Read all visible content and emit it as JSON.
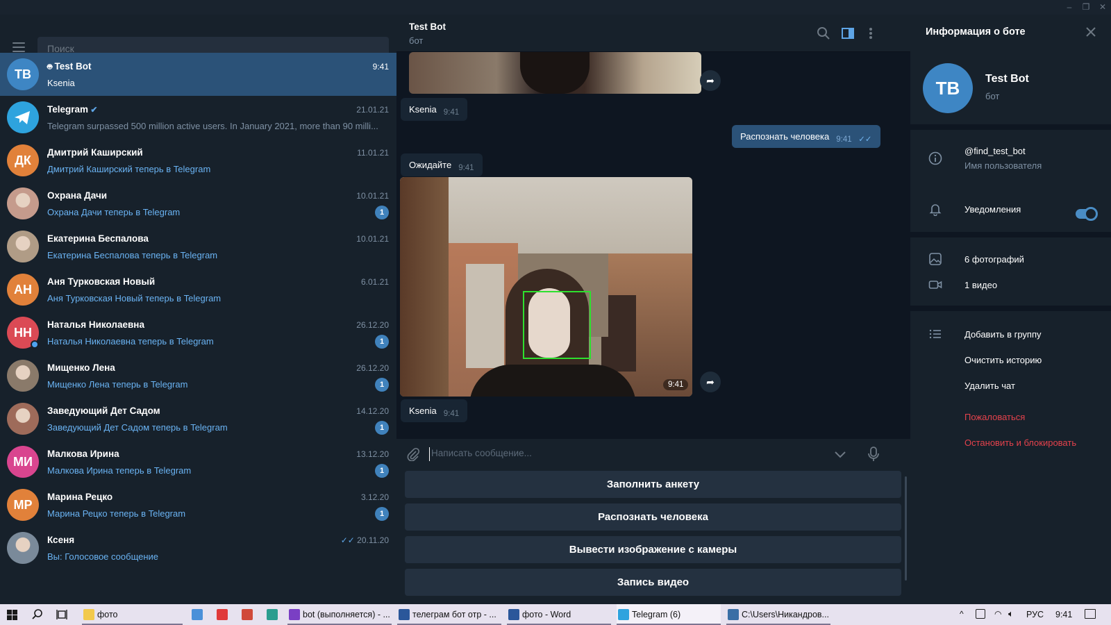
{
  "window": {
    "controls": [
      "–",
      "❐",
      "✕"
    ]
  },
  "search": {
    "placeholder": "Поиск"
  },
  "chats": [
    {
      "initials": "TB",
      "color": "#3e86c4",
      "name": "Test Bot",
      "preview": "Ksenia",
      "time": "9:41",
      "bot": true,
      "active": true
    },
    {
      "initials": "",
      "color": "#2ea3de",
      "name": "Telegram",
      "preview": "Telegram surpassed 500 million active users.    In January 2021, more than 90 milli...",
      "time": "21.01.21",
      "verified": true,
      "grey": true
    },
    {
      "initials": "ДК",
      "color": "#e1813a",
      "name": "Дмитрий Каширский",
      "preview": "Дмитрий Каширский теперь в Telegram",
      "time": "11.01.21"
    },
    {
      "initials": "",
      "color": "#c59b8c",
      "name": "Охрана Дачи",
      "preview": "Охрана Дачи теперь в Telegram",
      "time": "10.01.21",
      "badge": "1"
    },
    {
      "initials": "",
      "color": "#b09c86",
      "name": "Екатерина Беспалова",
      "preview": "Екатерина Беспалова теперь в Telegram",
      "time": "10.01.21"
    },
    {
      "initials": "АН",
      "color": "#e1813a",
      "name": "Аня Турковская Новый",
      "preview": "Аня Турковская Новый теперь в Telegram",
      "time": "6.01.21"
    },
    {
      "initials": "НН",
      "color": "#db4a55",
      "name": "Наталья Николаевна",
      "preview": "Наталья Николаевна теперь в Telegram",
      "time": "26.12.20",
      "badge": "1",
      "online": true
    },
    {
      "initials": "",
      "color": "#8a7a6a",
      "name": "Мищенко Лена",
      "preview": "Мищенко Лена теперь в Telegram",
      "time": "26.12.20",
      "badge": "1"
    },
    {
      "initials": "",
      "color": "#9e6b5a",
      "name": "Заведующий Дет Садом",
      "preview": "Заведующий Дет Садом теперь в Telegram",
      "time": "14.12.20",
      "badge": "1"
    },
    {
      "initials": "МИ",
      "color": "#d9458f",
      "name": "Малкова Ирина",
      "preview": "Малкова Ирина теперь в Telegram",
      "time": "13.12.20",
      "badge": "1"
    },
    {
      "initials": "МР",
      "color": "#e1813a",
      "name": "Марина Рецко",
      "preview": "Марина Рецко теперь в Telegram",
      "time": "3.12.20",
      "badge": "1"
    },
    {
      "initials": "",
      "color": "#7a8a9a",
      "name": "Ксеня",
      "preview": "Вы: Голосовое сообщение",
      "time": "20.11.20",
      "read": true
    }
  ],
  "chat": {
    "title": "Test Bot",
    "subtitle": "бот",
    "messages": {
      "m1_text": "Ksenia",
      "m1_time": "9:41",
      "m2_text": "Распознать человека",
      "m2_time": "9:41",
      "m3_text": "Ожидайте",
      "m3_time": "9:41",
      "photo_time": "9:41",
      "m4_text": "Ksenia",
      "m4_time": "9:41"
    },
    "input_placeholder": "Написать сообщение...",
    "keyboard": [
      "Заполнить анкету",
      "Распознать человека",
      "Вывести изображение с камеры",
      "Запись видео"
    ]
  },
  "info": {
    "header": "Информация о боте",
    "initials": "TB",
    "name": "Test Bot",
    "subtitle": "бот",
    "username": "@find_test_bot",
    "username_label": "Имя пользователя",
    "notifications": "Уведомления",
    "notifications_on": true,
    "photos": "6 фотографий",
    "videos": "1 видео",
    "add_group": "Добавить в группу",
    "clear_history": "Очистить историю",
    "delete_chat": "Удалить чат",
    "report": "Пожаловаться",
    "block": "Остановить и блокировать"
  },
  "taskbar": {
    "items": [
      {
        "label": "фото",
        "color": "#f2c94c"
      },
      {
        "label": "",
        "color": "#4a90d9"
      },
      {
        "label": "",
        "color": "#e03a3a"
      },
      {
        "label": "",
        "color": "#d04a3a"
      },
      {
        "label": "",
        "color": "#2a9d8f"
      },
      {
        "label": "bot (выполняется) - ...",
        "color": "#7a3fc4"
      },
      {
        "label": "телеграм бот отр - ...",
        "color": "#2b579a"
      },
      {
        "label": "фото - Word",
        "color": "#2b579a"
      },
      {
        "label": "Telegram (6)",
        "color": "#2ea3de"
      },
      {
        "label": "C:\\Users\\Никандров...",
        "color": "#3a6ea5"
      }
    ],
    "lang": "РУС",
    "time": "9:41"
  }
}
